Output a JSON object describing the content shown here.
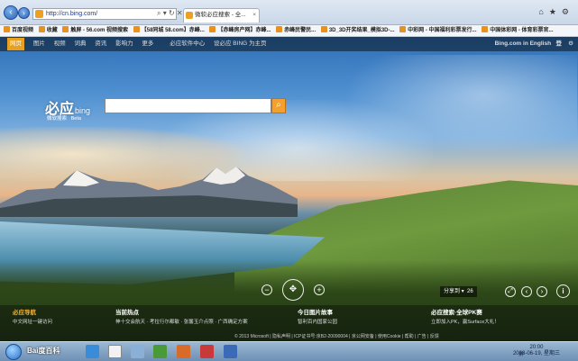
{
  "browser": {
    "address": "http://cn.bing.com/",
    "tab_title": "微软必应搜索 - 全...",
    "favorites": [
      "百度视频",
      "收藏",
      "触屏 - 56.com 视频搜索",
      "【58同城 58.com】赤峰...",
      "【赤峰房产网】赤峰...",
      "赤峰民警民...",
      "3D_3D开奖结果_模拟3D-...",
      "中彩网 - 中国福利彩票发行...",
      "中国体彩网 - 体育彩票官..."
    ]
  },
  "nav": {
    "items": [
      "网页",
      "图片",
      "视频",
      "词典",
      "资讯",
      "影响力",
      "更多"
    ],
    "extra": [
      "必应软件中心",
      "设必应 BING 为主页"
    ],
    "right_label": "Bing.com in English",
    "sign_in": "登"
  },
  "brand": {
    "logo": "必应",
    "logo_en": "bing",
    "tag1": "微软搜索",
    "tag2": "Beta"
  },
  "search": {
    "value": ""
  },
  "share": {
    "label": "分享到",
    "count": "26"
  },
  "sections": [
    {
      "title": "必应导航",
      "sub": "中文网址一键访问"
    },
    {
      "title": "当前热点",
      "sub": "神十交会航天 · 考拉行尔都敏 · 张馨玉介点照 · 广西确定方案"
    },
    {
      "title": "今日图片故事",
      "sub": "智利百内国家公园"
    },
    {
      "title": "必应搜索·全球PK赛",
      "sub": "立即加入PK，赢Surface大礼！"
    }
  ],
  "footer": "© 2013 Microsoft | 隐私声明 | ICP证书号:京B2-20090004 | 京公网安备 | 使用Cookie | 帮助 | 广告 | 反馈",
  "watermark": "Bai度百科",
  "taskbar": {
    "lang": "拼",
    "time": "20:00",
    "date": "2013-06-19, 星期三"
  },
  "colors": {
    "accent": "#e8a020",
    "taskbar": "#6e90b5"
  }
}
